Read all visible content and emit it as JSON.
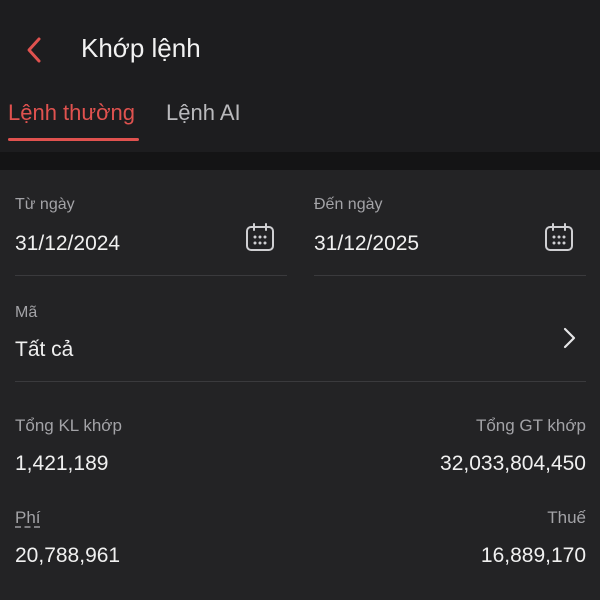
{
  "header": {
    "title": "Khớp lệnh",
    "accent_color": "#e0524f"
  },
  "tabs": [
    {
      "label": "Lệnh thường",
      "active": true
    },
    {
      "label": "Lệnh AI",
      "active": false
    }
  ],
  "filters": {
    "from_date": {
      "label": "Từ ngày",
      "value": "31/12/2024",
      "icon": "calendar-icon"
    },
    "to_date": {
      "label": "Đến ngày",
      "value": "31/12/2025",
      "icon": "calendar-icon"
    },
    "code": {
      "label": "Mã",
      "value": "Tất cả",
      "icon": "chevron-right-icon"
    }
  },
  "summary": {
    "total_volume": {
      "label": "Tổng KL khớp",
      "value": "1,421,189"
    },
    "total_value": {
      "label": "Tổng GT khớp",
      "value": "32,033,804,450"
    },
    "fee": {
      "label": "Phí",
      "value": "20,788,961"
    },
    "tax": {
      "label": "Thuế",
      "value": "16,889,170"
    }
  }
}
